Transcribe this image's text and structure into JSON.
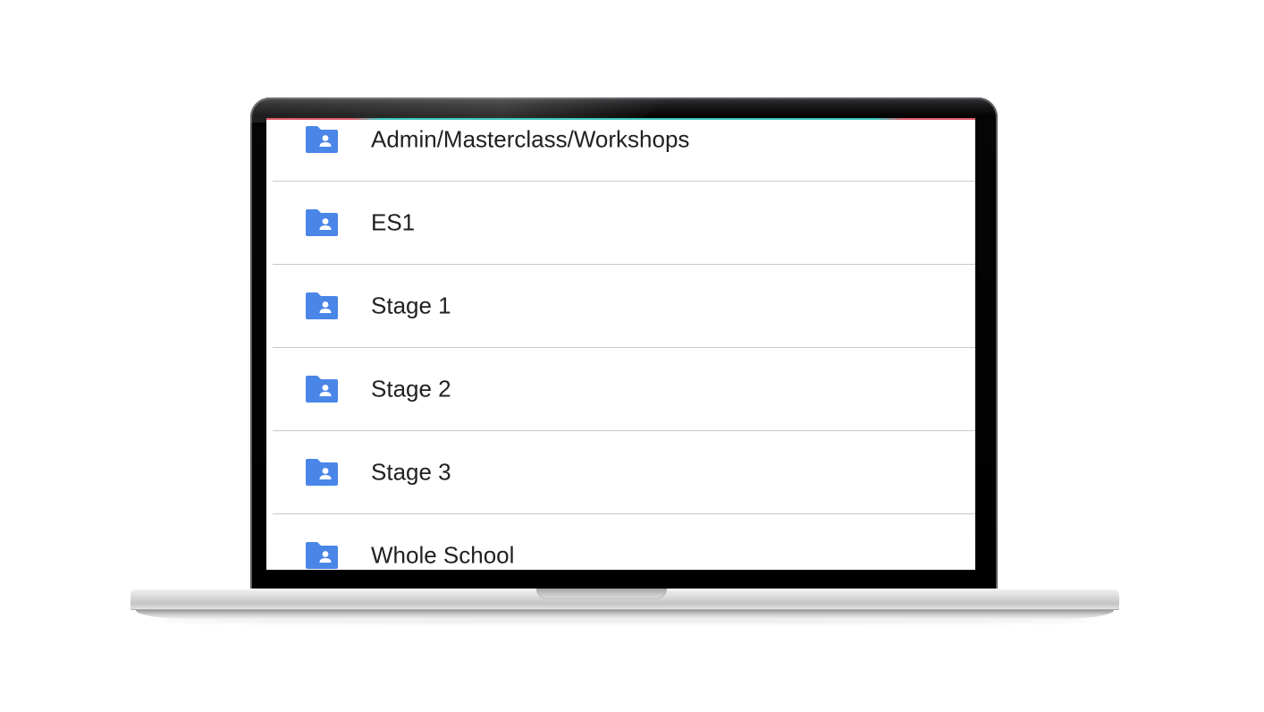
{
  "colors": {
    "folder_icon": "#4a86e8",
    "folder_person": "#ffffff",
    "text": "#202124",
    "divider": "#c9c9c9"
  },
  "folders": [
    {
      "name": "Admin/Masterclass/Workshops",
      "icon": "shared-folder-icon"
    },
    {
      "name": "ES1",
      "icon": "shared-folder-icon"
    },
    {
      "name": "Stage 1",
      "icon": "shared-folder-icon"
    },
    {
      "name": "Stage 2",
      "icon": "shared-folder-icon"
    },
    {
      "name": "Stage 3",
      "icon": "shared-folder-icon"
    },
    {
      "name": "Whole School",
      "icon": "shared-folder-icon"
    }
  ]
}
